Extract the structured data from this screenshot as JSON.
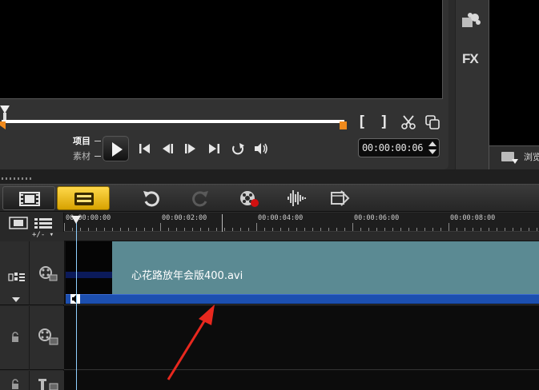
{
  "preview": {
    "mode_project": "项目",
    "mode_clip": "素材",
    "mark_in": "[",
    "mark_out": "]",
    "timecode": "00:00:00:06"
  },
  "side_panel": {
    "fx_label": "FX",
    "browse_label": "浏览"
  },
  "timeline": {
    "zoom_controls": "+/- ▾",
    "ruler_ticks": [
      "00:00:00:00",
      "00:00:02:00",
      "00:00:04:00",
      "00:00:06:00",
      "00:00:08:00"
    ],
    "video_clip_name": "心花路放年会版400.avi"
  },
  "colors": {
    "accent_yellow": "#f5c518",
    "clip_teal": "#5b8a93",
    "audio_blue": "#1c4fb0",
    "mark_orange": "#f08a1c",
    "annotation_red": "#e8281e"
  }
}
